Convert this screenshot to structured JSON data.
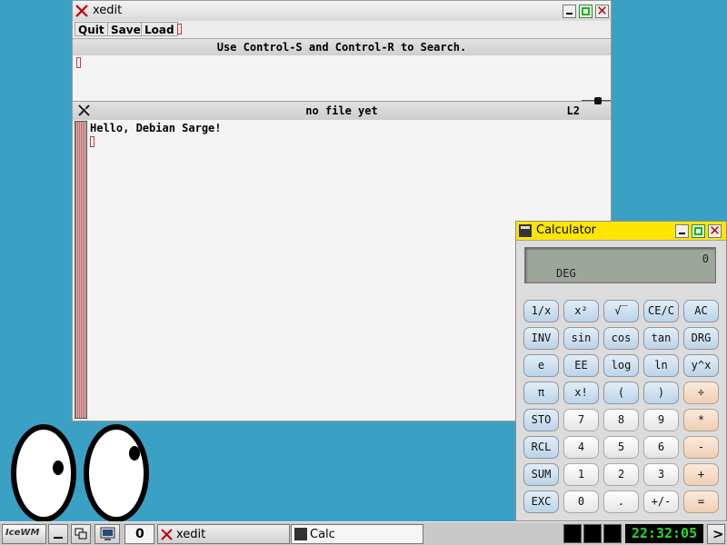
{
  "xedit": {
    "title": "xedit",
    "menu": {
      "quit": "Quit",
      "save": "Save",
      "load": "Load"
    },
    "message": "Use Control-S and Control-R to Search.",
    "filename": "no file yet",
    "line": "L2",
    "content_line1": "Hello, Debian Sarge!"
  },
  "calculator": {
    "title": "Calculator",
    "display_value": "0",
    "display_mode": "DEG",
    "keys": [
      [
        "1/x",
        "x²",
        "√‾",
        "CE/C",
        "AC"
      ],
      [
        "INV",
        "sin",
        "cos",
        "tan",
        "DRG"
      ],
      [
        "e",
        "EE",
        "log",
        "ln",
        "y^x"
      ],
      [
        "π",
        "x!",
        "(",
        ")",
        "÷"
      ],
      [
        "STO",
        "7",
        "8",
        "9",
        "*"
      ],
      [
        "RCL",
        "4",
        "5",
        "6",
        "-"
      ],
      [
        "SUM",
        "1",
        "2",
        "3",
        "+"
      ],
      [
        "EXC",
        "0",
        ".",
        "+/-",
        "="
      ]
    ]
  },
  "taskbar": {
    "logo": "IceWM",
    "workspace": "0",
    "tasks": [
      {
        "label": "xedit"
      },
      {
        "label": "Calc"
      }
    ],
    "clock": "22:32:05",
    "more": ">"
  }
}
